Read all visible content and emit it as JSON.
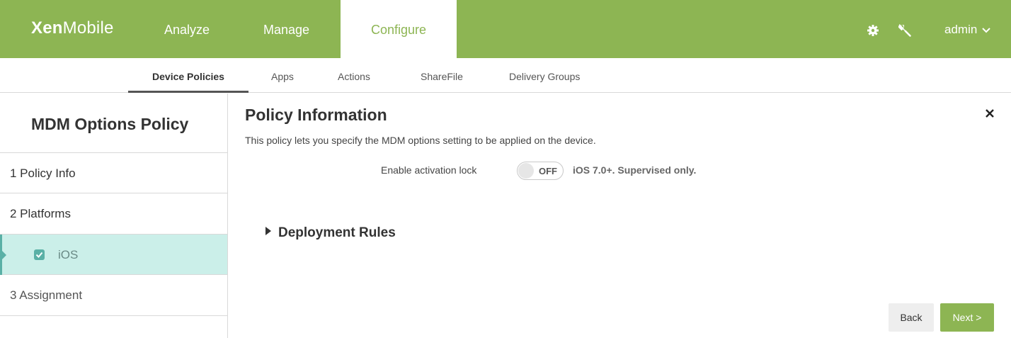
{
  "app": {
    "logo_bold": "Xen",
    "logo_rest": "Mobile"
  },
  "top_nav": {
    "analyze": "Analyze",
    "manage": "Manage",
    "configure": "Configure",
    "user": "admin"
  },
  "icons": {
    "settings": "gear-icon",
    "support": "wrench-icon",
    "user_menu": "chevron-down-icon",
    "close": "close-icon"
  },
  "sub_nav": {
    "device_policies": "Device Policies",
    "apps": "Apps",
    "actions": "Actions",
    "sharefile": "ShareFile",
    "delivery_groups": "Delivery Groups"
  },
  "left_panel": {
    "title": "MDM Options Policy",
    "items": {
      "policy_info": "1  Policy Info",
      "platforms": "2  Platforms",
      "ios": "iOS",
      "assignment": "3  Assignment"
    }
  },
  "main": {
    "title": "Policy Information",
    "description": "This policy lets you specify the MDM options setting to be applied on the device.",
    "activation_lock": {
      "label": "Enable activation lock",
      "state": "OFF",
      "note": "iOS 7.0+. Supervised only."
    },
    "deployment_rules": "Deployment Rules",
    "buttons": {
      "back": "Back",
      "next": "Next >"
    }
  },
  "colors": {
    "brand_green": "#8db553",
    "selected_bg": "#cbefe9",
    "selected_accent": "#5ab0a6"
  }
}
